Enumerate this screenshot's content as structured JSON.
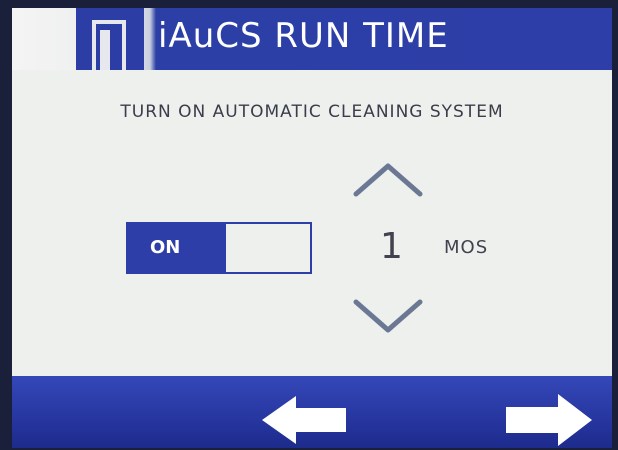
{
  "header": {
    "title": "iAuCS RUN TIME",
    "logo_icon": "iaucs-logo-icon"
  },
  "main": {
    "instruction": "TURN ON AUTOMATIC CLEANING SYSTEM",
    "toggle": {
      "label": "ON",
      "state": "on"
    },
    "stepper": {
      "value": "1",
      "unit": "MOS",
      "increment_icon": "chevron-up-icon",
      "decrement_icon": "chevron-down-icon"
    }
  },
  "footer": {
    "back_icon": "arrow-left-icon",
    "next_icon": "arrow-right-icon"
  },
  "colors": {
    "accent": "#2e3ea8",
    "background": "#eef0ee",
    "text": "#40434f"
  }
}
